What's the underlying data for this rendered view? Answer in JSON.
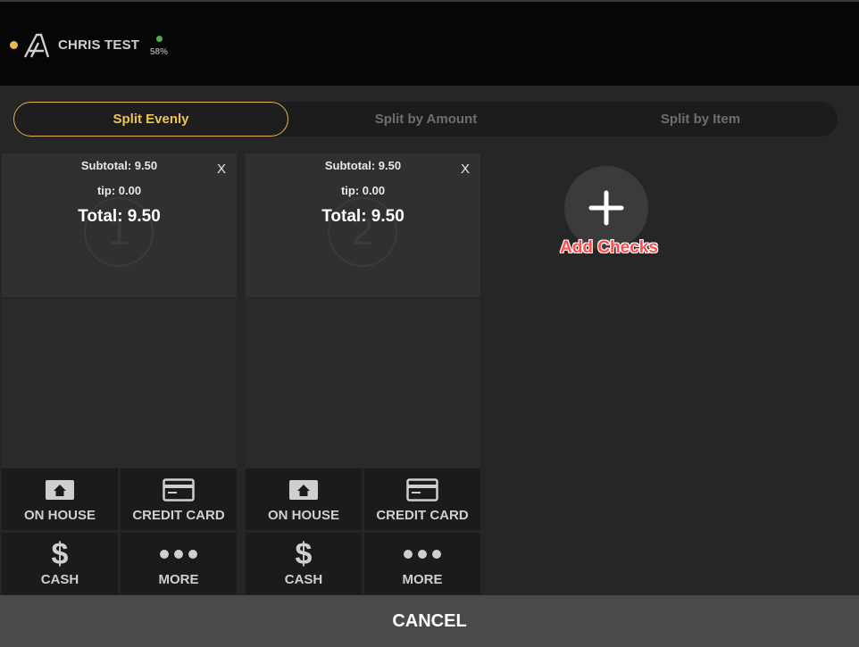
{
  "header": {
    "user_name": "CHRIS TEST",
    "battery": "58%",
    "status_color": "#e7b84f",
    "battery_color": "#4caf50"
  },
  "tabs": [
    {
      "label": "Split Evenly",
      "active": true
    },
    {
      "label": "Split by Amount",
      "active": false
    },
    {
      "label": "Split by Item",
      "active": false
    }
  ],
  "checks": [
    {
      "number": "1",
      "subtotal": "Subtotal: 9.50",
      "tip": "tip: 0.00",
      "total": "Total: 9.50",
      "close": "X",
      "actions": [
        "ON HOUSE",
        "CREDIT CARD",
        "CASH",
        "MORE"
      ]
    },
    {
      "number": "2",
      "subtotal": "Subtotal: 9.50",
      "tip": "tip: 0.00",
      "total": "Total: 9.50",
      "close": "X",
      "actions": [
        "ON HOUSE",
        "CREDIT CARD",
        "CASH",
        "MORE"
      ]
    }
  ],
  "add_checks": {
    "label": "Add Checks"
  },
  "footer": {
    "cancel_label": "CANCEL"
  },
  "colors": {
    "accent": "#e3b54a",
    "annotation": "#ff4d4d"
  }
}
